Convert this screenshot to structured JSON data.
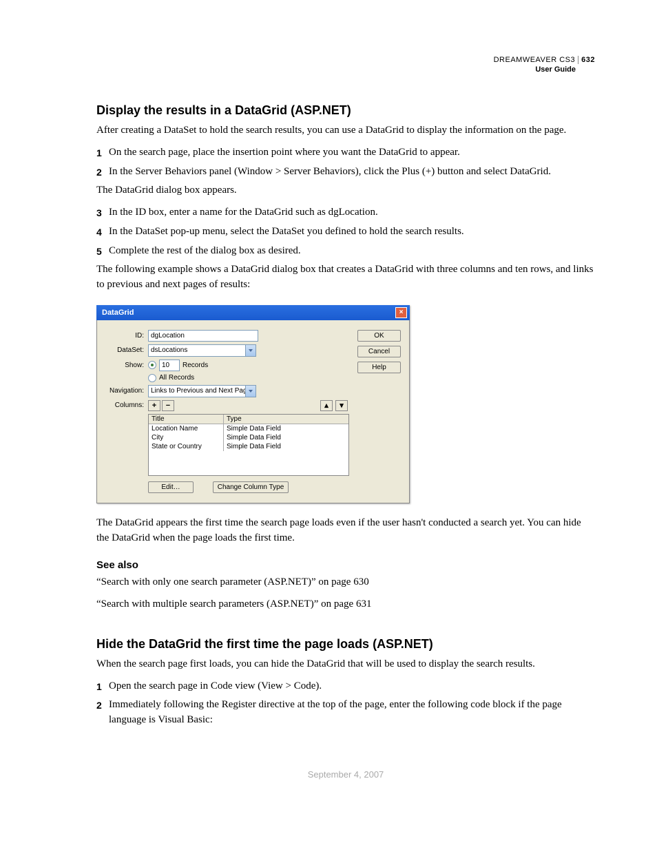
{
  "header": {
    "product": "DREAMWEAVER CS3",
    "page_number": "632",
    "subtitle": "User Guide"
  },
  "section1": {
    "title": "Display the results in a DataGrid (ASP.NET)",
    "intro": "After creating a DataSet to hold the search results, you can use a DataGrid to display the information on the page.",
    "steps": [
      "On the search page, place the insertion point where you want the DataGrid to appear.",
      "In the Server Behaviors panel (Window > Server Behaviors), click the Plus (+) button and select DataGrid."
    ],
    "after_step2": "The DataGrid dialog box appears.",
    "steps_b": [
      "In the ID box, enter a name for the DataGrid such as dgLocation.",
      "In the DataSet pop-up menu, select the DataSet you defined to hold the search results.",
      "Complete the rest of the dialog box as desired."
    ],
    "example_intro": "The following example shows a DataGrid dialog box that creates a DataGrid with three columns and ten rows, and links to previous and next pages of results:",
    "after_dialog": "The DataGrid appears the first time the search page loads even if the user hasn't conducted a search yet. You can hide the DataGrid when the page loads the first time."
  },
  "dialog": {
    "title": "DataGrid",
    "buttons": {
      "ok": "OK",
      "cancel": "Cancel",
      "help": "Help"
    },
    "labels": {
      "id": "ID:",
      "dataset": "DataSet:",
      "show": "Show:",
      "navigation": "Navigation:",
      "columns": "Columns:"
    },
    "id_value": "dgLocation",
    "dataset_value": "dsLocations",
    "records_num": "10",
    "records_label": "Records",
    "all_records": "All Records",
    "nav_value": "Links to Previous and Next Pages",
    "col_head_title": "Title",
    "col_head_type": "Type",
    "rows": [
      {
        "title": "Location Name",
        "type": "Simple Data Field"
      },
      {
        "title": "City",
        "type": "Simple Data Field"
      },
      {
        "title": "State or Country",
        "type": "Simple Data Field"
      }
    ],
    "edit": "Edit…",
    "change_type": "Change Column Type"
  },
  "see_also": {
    "title": "See also",
    "links": [
      "“Search with only one search parameter (ASP.NET)” on page 630",
      "“Search with multiple search parameters (ASP.NET)” on page 631"
    ]
  },
  "section2": {
    "title": "Hide the DataGrid the first time the page loads (ASP.NET)",
    "intro": "When the search page first loads, you can hide the DataGrid that will be used to display the search results.",
    "steps": [
      "Open the search page in Code view (View > Code).",
      "Immediately following the Register directive at the top of the page, enter the following code block if the page language is Visual Basic:"
    ]
  },
  "footer_date": "September 4, 2007"
}
